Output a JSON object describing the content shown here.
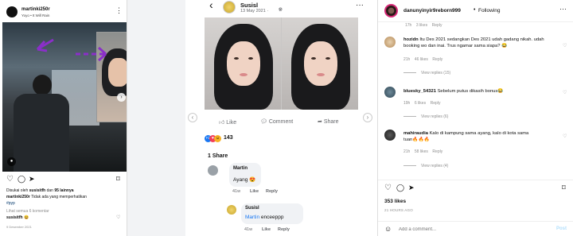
{
  "left_post": {
    "username": "martinki250r",
    "music": "Yoyo • It Will Rain",
    "liked_by_prefix": "Disukai oleh",
    "liked_by_user": "susisitfh",
    "liked_by_and": "dan",
    "liked_by_count": "95 lainnya",
    "caption_user": "martinki250r",
    "caption_text": "Tidak ada yang memperhatikan",
    "hashtag": "#pyp",
    "view_comments": "Lihat semua 6 komentar",
    "top_comment_user": "susisitfh",
    "top_comment_emoji": "😆",
    "date": "9 Desember 2021"
  },
  "fb_post": {
    "author": "Susisl",
    "date": "13 May 2021 ·",
    "like_label": "Like",
    "comment_label": "Comment",
    "share_label": "Share",
    "reaction_count": "143",
    "shares": "1 Share",
    "comments": [
      {
        "author": "Martin",
        "text": "Ayang 😍",
        "time": "41w",
        "like": "Like",
        "reply": "Reply"
      },
      {
        "author": "Susisl",
        "tag": "Martin",
        "text": "enceeppp",
        "time": "41w",
        "like": "Like",
        "reply": "Reply"
      }
    ]
  },
  "ig_comments": {
    "username": "danunyinyir9reborn999",
    "follow_status": "Following",
    "top_meta": [
      "17h",
      "3 likes",
      "Reply"
    ],
    "items": [
      {
        "user": "hozidn",
        "text": "Itu Des 2021 sedangkan Des 2021 udah gadang nikah. udah booking wo dan inai. Trus ngamar sama siapa? 😂",
        "time": "21h",
        "likes": "46 likes",
        "reply": "Reply",
        "view_replies": "View replies (15)"
      },
      {
        "user": "bluesky_54321",
        "text": "Sebelum putus dikasih bonus😂",
        "time": "19h",
        "likes": "6 likes",
        "reply": "Reply",
        "view_replies": "View replies (6)"
      },
      {
        "user": "mahiraudia",
        "text": "Kalo di kampung sama ayang, kalo di kota sama tuan🔥🔥🔥",
        "time": "21h",
        "likes": "58 likes",
        "reply": "Reply",
        "view_replies": "View replies (4)"
      }
    ],
    "likes_count": "353 likes",
    "time_ago": "21 HOURS AGO",
    "add_comment_placeholder": "Add a comment...",
    "post_label": "Post"
  },
  "colors": {
    "ig_link": "#00376b",
    "fb_blue": "#1877f2",
    "annotation_purple": "#8a2fc8",
    "muted": "#8e8e8e"
  }
}
